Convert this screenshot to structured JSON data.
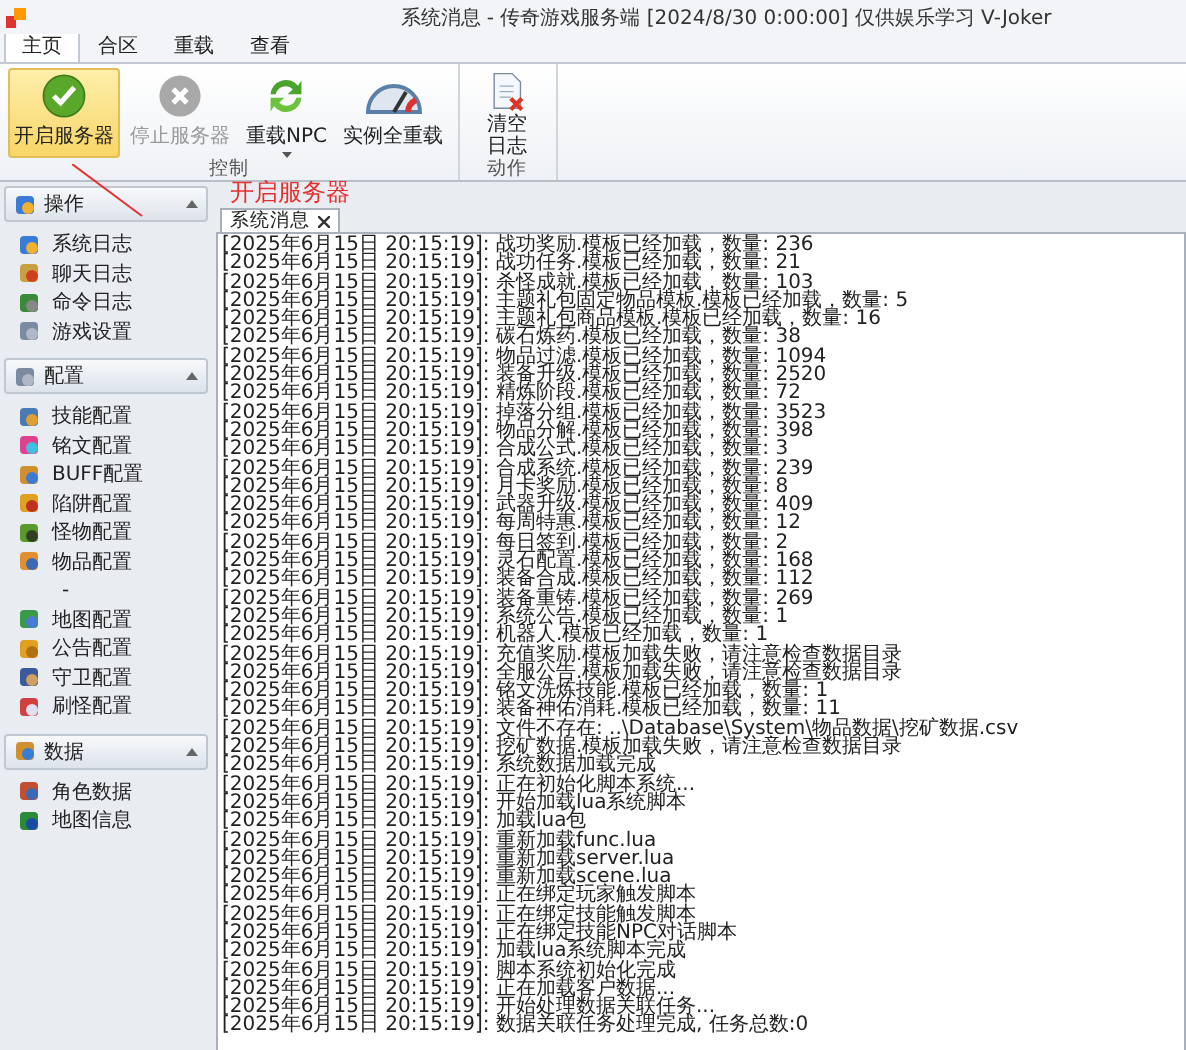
{
  "window": {
    "title": "系统消息 - 传奇游戏服务端 [2024/8/30 0:00:00] 仅供娱乐学习  V-Joker"
  },
  "ribbon_tabs": [
    {
      "label": "主页",
      "selected": true
    },
    {
      "label": "合区",
      "selected": false
    },
    {
      "label": "重载",
      "selected": false
    },
    {
      "label": "查看",
      "selected": false
    }
  ],
  "ribbon_groups": [
    {
      "label": "控制",
      "buttons": [
        {
          "label": "开启服务器",
          "highlighted": true,
          "disabled": false
        },
        {
          "label": "停止服务器",
          "highlighted": false,
          "disabled": true
        },
        {
          "label": "重载NPC",
          "highlighted": false,
          "disabled": false,
          "dropdown": true
        },
        {
          "label": "实例全重载",
          "highlighted": false,
          "disabled": false
        }
      ]
    },
    {
      "label": "动作",
      "buttons": [
        {
          "label": "清空日志",
          "highlighted": false,
          "disabled": false
        }
      ]
    }
  ],
  "annotation": {
    "text": "开启服务器"
  },
  "sidebar": {
    "sections": [
      {
        "title": "操作",
        "expanded": true,
        "items": [
          "系统日志",
          "聊天日志",
          "命令日志",
          "游戏设置"
        ]
      },
      {
        "title": "配置",
        "expanded": true,
        "items": [
          "技能配置",
          "铭文配置",
          "BUFF配置",
          "陷阱配置",
          "怪物配置",
          "物品配置",
          "-",
          "地图配置",
          "公告配置",
          "守卫配置",
          "刷怪配置"
        ]
      },
      {
        "title": "数据",
        "expanded": true,
        "items": [
          "角色数据",
          "地图信息"
        ]
      }
    ]
  },
  "doc_tabs": [
    {
      "label": "系统消息",
      "selected": true
    }
  ],
  "log_lines": [
    "[2025年6月15日 20:15:19]: 战功奖励.模板已经加载，数量: 236",
    "[2025年6月15日 20:15:19]: 战功任务.模板已经加载，数量: 21",
    "[2025年6月15日 20:15:19]: 杀怪成就.模板已经加载，数量: 103",
    "[2025年6月15日 20:15:19]: 主题礼包固定物品模板.模板已经加载，数量: 5",
    "[2025年6月15日 20:15:19]: 主题礼包商品模板.模板已经加载，数量: 16",
    "[2025年6月15日 20:15:19]: 碳石炼药.模板已经加载，数量: 38",
    "[2025年6月15日 20:15:19]: 物品过滤.模板已经加载，数量: 1094",
    "[2025年6月15日 20:15:19]: 装备升级.模板已经加载，数量: 2520",
    "[2025年6月15日 20:15:19]: 精炼阶段.模板已经加载，数量: 72",
    "[2025年6月15日 20:15:19]: 掉落分组.模板已经加载，数量: 3523",
    "[2025年6月15日 20:15:19]: 物品分解.模板已经加载，数量: 398",
    "[2025年6月15日 20:15:19]: 合成公式.模板已经加载，数量: 3",
    "[2025年6月15日 20:15:19]: 合成系统.模板已经加载，数量: 239",
    "[2025年6月15日 20:15:19]: 月卡奖励.模板已经加载，数量: 8",
    "[2025年6月15日 20:15:19]: 武器升级.模板已经加载，数量: 409",
    "[2025年6月15日 20:15:19]: 每周特惠.模板已经加载，数量: 12",
    "[2025年6月15日 20:15:19]: 每日签到.模板已经加载，数量: 2",
    "[2025年6月15日 20:15:19]: 灵石配置.模板已经加载，数量: 168",
    "[2025年6月15日 20:15:19]: 装备合成.模板已经加载，数量: 112",
    "[2025年6月15日 20:15:19]: 装备重铸.模板已经加载，数量: 269",
    "[2025年6月15日 20:15:19]: 系统公告.模板已经加载，数量: 1",
    "[2025年6月15日 20:15:19]: 机器人.模板已经加载，数量: 1",
    "[2025年6月15日 20:15:19]: 充值奖励.模板加载失败，请注意检查数据目录",
    "[2025年6月15日 20:15:19]: 全服公告.模板加载失败，请注意检查数据目录",
    "[2025年6月15日 20:15:19]: 铭文洗炼技能.模板已经加载，数量: 1",
    "[2025年6月15日 20:15:19]: 装备神佑消耗.模板已经加载，数量: 11",
    "[2025年6月15日 20:15:19]: 文件不存在: ..\\Database\\System\\物品数据\\挖矿数据.csv",
    "[2025年6月15日 20:15:19]: 挖矿数据.模板加载失败，请注意检查数据目录",
    "[2025年6月15日 20:15:19]: 系统数据加载完成",
    "[2025年6月15日 20:15:19]: 正在初始化脚本系统...",
    "[2025年6月15日 20:15:19]: 开始加载lua系统脚本",
    "[2025年6月15日 20:15:19]: 加载lua包",
    "[2025年6月15日 20:15:19]: 重新加载func.lua",
    "[2025年6月15日 20:15:19]: 重新加载server.lua",
    "[2025年6月15日 20:15:19]: 重新加载scene.lua",
    "[2025年6月15日 20:15:19]: 正在绑定玩家触发脚本",
    "[2025年6月15日 20:15:19]: 正在绑定技能触发脚本",
    "[2025年6月15日 20:15:19]: 正在绑定技能NPC对话脚本",
    "[2025年6月15日 20:15:19]: 加载lua系统脚本完成",
    "[2025年6月15日 20:15:19]: 脚本系统初始化完成",
    "[2025年6月15日 20:15:19]: 正在加载客户数据...",
    "[2025年6月15日 20:15:19]: 开始处理数据关联任务...",
    "[2025年6月15日 20:15:19]: 数据关联任务处理完成, 任务总数:0"
  ]
}
